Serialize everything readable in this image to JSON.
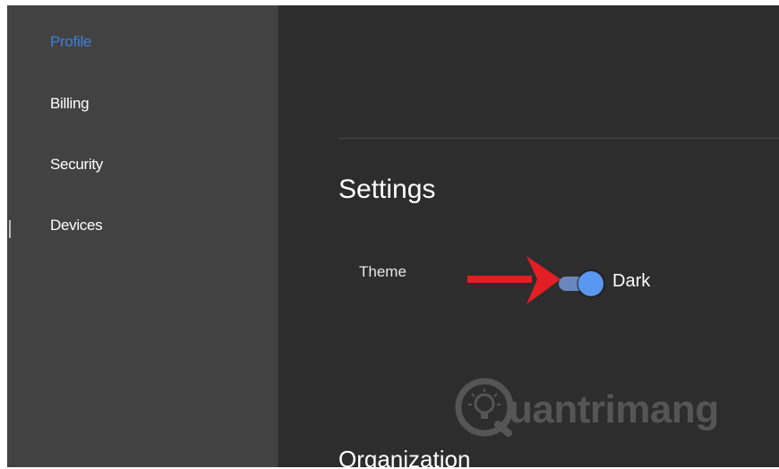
{
  "sidebar": {
    "items": [
      {
        "label": "Profile",
        "active": true
      },
      {
        "label": "Billing",
        "active": false
      },
      {
        "label": "Security",
        "active": false
      },
      {
        "label": "Devices",
        "active": false
      }
    ]
  },
  "main": {
    "title": "Settings",
    "theme": {
      "label": "Theme",
      "value": "Dark",
      "enabled": true
    },
    "next_section": "Organization"
  },
  "watermark": {
    "text": "uantrimang",
    "logo_icon": "lightbulb-icon"
  },
  "annotation": {
    "arrow_color": "#e31e24",
    "icon": "arrow-right-icon"
  },
  "colors": {
    "accent": "#3f7fd8",
    "sidebar_bg": "#424242",
    "content_bg": "#2d2d2d",
    "toggle_knob": "#5a97f2",
    "toggle_track": "#6a87bd"
  }
}
